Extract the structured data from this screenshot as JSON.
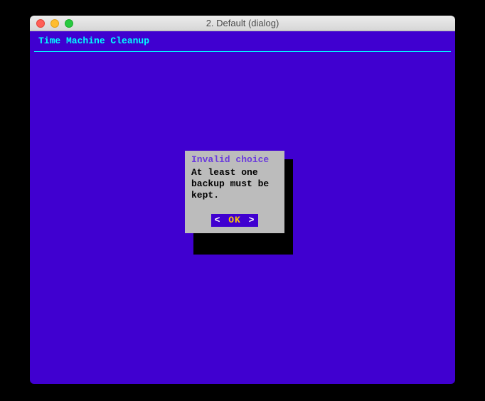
{
  "window": {
    "title": "2. Default (dialog)"
  },
  "terminal": {
    "app_title": "Time Machine Cleanup",
    "colors": {
      "background": "#4000d0",
      "title_fg": "#00ffff",
      "dialog_bg": "#bcbcbc",
      "dialog_title_fg": "#6a3bdc",
      "button_bg": "#4000d0",
      "button_label_fg": "#ffcc00"
    }
  },
  "dialog": {
    "title": "Invalid choice",
    "message": "At least one\nbackup must be\nkept.",
    "ok_label": "OK",
    "lt": "<",
    "gt": ">"
  }
}
